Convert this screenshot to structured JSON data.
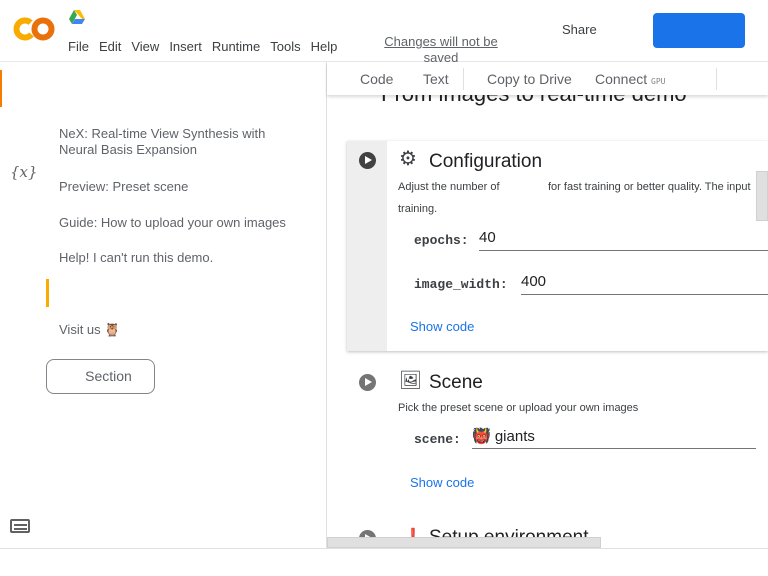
{
  "header": {
    "menu": [
      "File",
      "Edit",
      "View",
      "Insert",
      "Runtime",
      "Tools",
      "Help"
    ],
    "changes_notice": "Changes will not be saved",
    "share_label": "Share",
    "brand_color": "#f9ab00",
    "primary_button_color": "#1a73e8"
  },
  "toolbar": {
    "code_label": "Code",
    "text_label": "Text",
    "copy_label": "Copy to Drive",
    "connect_label": "Connect",
    "gpu_label": "GPU"
  },
  "toc": {
    "items": [
      "NeX: Real-time View Synthesis with Neural Basis Expansion",
      "Preview: Preset scene",
      "Guide: How to upload your own images",
      "Help! I can't run this demo.",
      "Visit us 🦉"
    ],
    "section_button": "Section"
  },
  "sidebar": {
    "variables_icon": "{x}"
  },
  "notebook": {
    "heading": "From images to real-time demo",
    "cells": [
      {
        "title": "Configuration",
        "icon": "⚙",
        "description_part1": "Adjust the number of",
        "description_part2": "for fast training or better quality. The input",
        "description_line2": "training.",
        "params": [
          {
            "name": "epochs:",
            "value": "40"
          },
          {
            "name": "image_width:",
            "value": "400"
          }
        ],
        "show_code": "Show code"
      },
      {
        "title": "Scene",
        "icon": "🖼",
        "description": "Pick the preset scene or upload your own images",
        "params": [
          {
            "name": "scene:",
            "value": "👹 giants"
          }
        ],
        "show_code": "Show code"
      },
      {
        "title": "Setup environment",
        "icon": "❗"
      }
    ]
  }
}
